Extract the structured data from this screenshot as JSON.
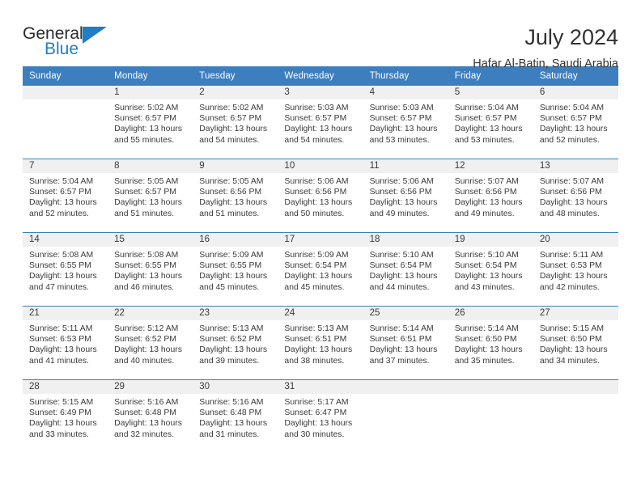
{
  "brand": {
    "name_part1": "General",
    "name_part2": "Blue",
    "accent_color": "#1f7ec4"
  },
  "header": {
    "title": "July 2024",
    "subtitle": "Hafar Al-Batin, Saudi Arabia"
  },
  "calendar": {
    "header_color": "#3d7ebf",
    "weekday_headers": [
      "Sunday",
      "Monday",
      "Tuesday",
      "Wednesday",
      "Thursday",
      "Friday",
      "Saturday"
    ],
    "weeks": [
      [
        {
          "day": "",
          "sunrise": "",
          "sunset": "",
          "daylight_line1": "",
          "daylight_line2": ""
        },
        {
          "day": "1",
          "sunrise": "Sunrise: 5:02 AM",
          "sunset": "Sunset: 6:57 PM",
          "daylight_line1": "Daylight: 13 hours",
          "daylight_line2": "and 55 minutes."
        },
        {
          "day": "2",
          "sunrise": "Sunrise: 5:02 AM",
          "sunset": "Sunset: 6:57 PM",
          "daylight_line1": "Daylight: 13 hours",
          "daylight_line2": "and 54 minutes."
        },
        {
          "day": "3",
          "sunrise": "Sunrise: 5:03 AM",
          "sunset": "Sunset: 6:57 PM",
          "daylight_line1": "Daylight: 13 hours",
          "daylight_line2": "and 54 minutes."
        },
        {
          "day": "4",
          "sunrise": "Sunrise: 5:03 AM",
          "sunset": "Sunset: 6:57 PM",
          "daylight_line1": "Daylight: 13 hours",
          "daylight_line2": "and 53 minutes."
        },
        {
          "day": "5",
          "sunrise": "Sunrise: 5:04 AM",
          "sunset": "Sunset: 6:57 PM",
          "daylight_line1": "Daylight: 13 hours",
          "daylight_line2": "and 53 minutes."
        },
        {
          "day": "6",
          "sunrise": "Sunrise: 5:04 AM",
          "sunset": "Sunset: 6:57 PM",
          "daylight_line1": "Daylight: 13 hours",
          "daylight_line2": "and 52 minutes."
        }
      ],
      [
        {
          "day": "7",
          "sunrise": "Sunrise: 5:04 AM",
          "sunset": "Sunset: 6:57 PM",
          "daylight_line1": "Daylight: 13 hours",
          "daylight_line2": "and 52 minutes."
        },
        {
          "day": "8",
          "sunrise": "Sunrise: 5:05 AM",
          "sunset": "Sunset: 6:57 PM",
          "daylight_line1": "Daylight: 13 hours",
          "daylight_line2": "and 51 minutes."
        },
        {
          "day": "9",
          "sunrise": "Sunrise: 5:05 AM",
          "sunset": "Sunset: 6:56 PM",
          "daylight_line1": "Daylight: 13 hours",
          "daylight_line2": "and 51 minutes."
        },
        {
          "day": "10",
          "sunrise": "Sunrise: 5:06 AM",
          "sunset": "Sunset: 6:56 PM",
          "daylight_line1": "Daylight: 13 hours",
          "daylight_line2": "and 50 minutes."
        },
        {
          "day": "11",
          "sunrise": "Sunrise: 5:06 AM",
          "sunset": "Sunset: 6:56 PM",
          "daylight_line1": "Daylight: 13 hours",
          "daylight_line2": "and 49 minutes."
        },
        {
          "day": "12",
          "sunrise": "Sunrise: 5:07 AM",
          "sunset": "Sunset: 6:56 PM",
          "daylight_line1": "Daylight: 13 hours",
          "daylight_line2": "and 49 minutes."
        },
        {
          "day": "13",
          "sunrise": "Sunrise: 5:07 AM",
          "sunset": "Sunset: 6:56 PM",
          "daylight_line1": "Daylight: 13 hours",
          "daylight_line2": "and 48 minutes."
        }
      ],
      [
        {
          "day": "14",
          "sunrise": "Sunrise: 5:08 AM",
          "sunset": "Sunset: 6:55 PM",
          "daylight_line1": "Daylight: 13 hours",
          "daylight_line2": "and 47 minutes."
        },
        {
          "day": "15",
          "sunrise": "Sunrise: 5:08 AM",
          "sunset": "Sunset: 6:55 PM",
          "daylight_line1": "Daylight: 13 hours",
          "daylight_line2": "and 46 minutes."
        },
        {
          "day": "16",
          "sunrise": "Sunrise: 5:09 AM",
          "sunset": "Sunset: 6:55 PM",
          "daylight_line1": "Daylight: 13 hours",
          "daylight_line2": "and 45 minutes."
        },
        {
          "day": "17",
          "sunrise": "Sunrise: 5:09 AM",
          "sunset": "Sunset: 6:54 PM",
          "daylight_line1": "Daylight: 13 hours",
          "daylight_line2": "and 45 minutes."
        },
        {
          "day": "18",
          "sunrise": "Sunrise: 5:10 AM",
          "sunset": "Sunset: 6:54 PM",
          "daylight_line1": "Daylight: 13 hours",
          "daylight_line2": "and 44 minutes."
        },
        {
          "day": "19",
          "sunrise": "Sunrise: 5:10 AM",
          "sunset": "Sunset: 6:54 PM",
          "daylight_line1": "Daylight: 13 hours",
          "daylight_line2": "and 43 minutes."
        },
        {
          "day": "20",
          "sunrise": "Sunrise: 5:11 AM",
          "sunset": "Sunset: 6:53 PM",
          "daylight_line1": "Daylight: 13 hours",
          "daylight_line2": "and 42 minutes."
        }
      ],
      [
        {
          "day": "21",
          "sunrise": "Sunrise: 5:11 AM",
          "sunset": "Sunset: 6:53 PM",
          "daylight_line1": "Daylight: 13 hours",
          "daylight_line2": "and 41 minutes."
        },
        {
          "day": "22",
          "sunrise": "Sunrise: 5:12 AM",
          "sunset": "Sunset: 6:52 PM",
          "daylight_line1": "Daylight: 13 hours",
          "daylight_line2": "and 40 minutes."
        },
        {
          "day": "23",
          "sunrise": "Sunrise: 5:13 AM",
          "sunset": "Sunset: 6:52 PM",
          "daylight_line1": "Daylight: 13 hours",
          "daylight_line2": "and 39 minutes."
        },
        {
          "day": "24",
          "sunrise": "Sunrise: 5:13 AM",
          "sunset": "Sunset: 6:51 PM",
          "daylight_line1": "Daylight: 13 hours",
          "daylight_line2": "and 38 minutes."
        },
        {
          "day": "25",
          "sunrise": "Sunrise: 5:14 AM",
          "sunset": "Sunset: 6:51 PM",
          "daylight_line1": "Daylight: 13 hours",
          "daylight_line2": "and 37 minutes."
        },
        {
          "day": "26",
          "sunrise": "Sunrise: 5:14 AM",
          "sunset": "Sunset: 6:50 PM",
          "daylight_line1": "Daylight: 13 hours",
          "daylight_line2": "and 35 minutes."
        },
        {
          "day": "27",
          "sunrise": "Sunrise: 5:15 AM",
          "sunset": "Sunset: 6:50 PM",
          "daylight_line1": "Daylight: 13 hours",
          "daylight_line2": "and 34 minutes."
        }
      ],
      [
        {
          "day": "28",
          "sunrise": "Sunrise: 5:15 AM",
          "sunset": "Sunset: 6:49 PM",
          "daylight_line1": "Daylight: 13 hours",
          "daylight_line2": "and 33 minutes."
        },
        {
          "day": "29",
          "sunrise": "Sunrise: 5:16 AM",
          "sunset": "Sunset: 6:48 PM",
          "daylight_line1": "Daylight: 13 hours",
          "daylight_line2": "and 32 minutes."
        },
        {
          "day": "30",
          "sunrise": "Sunrise: 5:16 AM",
          "sunset": "Sunset: 6:48 PM",
          "daylight_line1": "Daylight: 13 hours",
          "daylight_line2": "and 31 minutes."
        },
        {
          "day": "31",
          "sunrise": "Sunrise: 5:17 AM",
          "sunset": "Sunset: 6:47 PM",
          "daylight_line1": "Daylight: 13 hours",
          "daylight_line2": "and 30 minutes."
        },
        {
          "day": "",
          "sunrise": "",
          "sunset": "",
          "daylight_line1": "",
          "daylight_line2": ""
        },
        {
          "day": "",
          "sunrise": "",
          "sunset": "",
          "daylight_line1": "",
          "daylight_line2": ""
        },
        {
          "day": "",
          "sunrise": "",
          "sunset": "",
          "daylight_line1": "",
          "daylight_line2": ""
        }
      ]
    ]
  }
}
